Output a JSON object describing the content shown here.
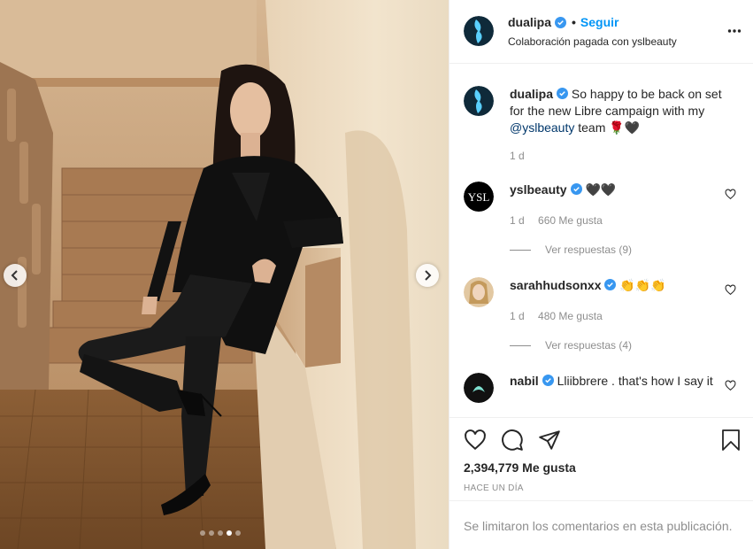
{
  "post": {
    "author": "dualipa",
    "follow_label": "Seguir",
    "bullet": "•",
    "paid_partnership": "Colaboración pagada con yslbeauty"
  },
  "caption": {
    "user": "dualipa",
    "text": " So happy to be back on set for the new Libre campaign with my ",
    "mention": "@yslbeauty",
    "tail": " team 🌹🖤",
    "time": "1 d"
  },
  "comments": [
    {
      "user": "yslbeauty",
      "text": "🖤🖤",
      "time": "1 d",
      "likes": "660 Me gusta",
      "replies": "Ver respuestas (9)"
    },
    {
      "user": "sarahhudsonxx",
      "text": "👏👏👏",
      "time": "1 d",
      "likes": "480 Me gusta",
      "replies": "Ver respuestas (4)"
    },
    {
      "user": "nabil",
      "text": "Lliibbrere . that's how I say it"
    }
  ],
  "footer": {
    "likes": "2,394,779 Me gusta",
    "time": "HACE UN DÍA",
    "comments_limited": "Se limitaron los comentarios en esta publicación."
  },
  "carousel": {
    "total": 5,
    "active_index": 3
  },
  "colors": {
    "link": "#0095f6",
    "verified": "#3897f0",
    "muted": "#8e8e8e",
    "text": "#262626"
  },
  "icons": [
    "chevron-left-icon",
    "chevron-right-icon",
    "verified-badge-icon",
    "more-options-icon",
    "heart-icon",
    "comment-icon",
    "share-icon",
    "bookmark-icon"
  ]
}
